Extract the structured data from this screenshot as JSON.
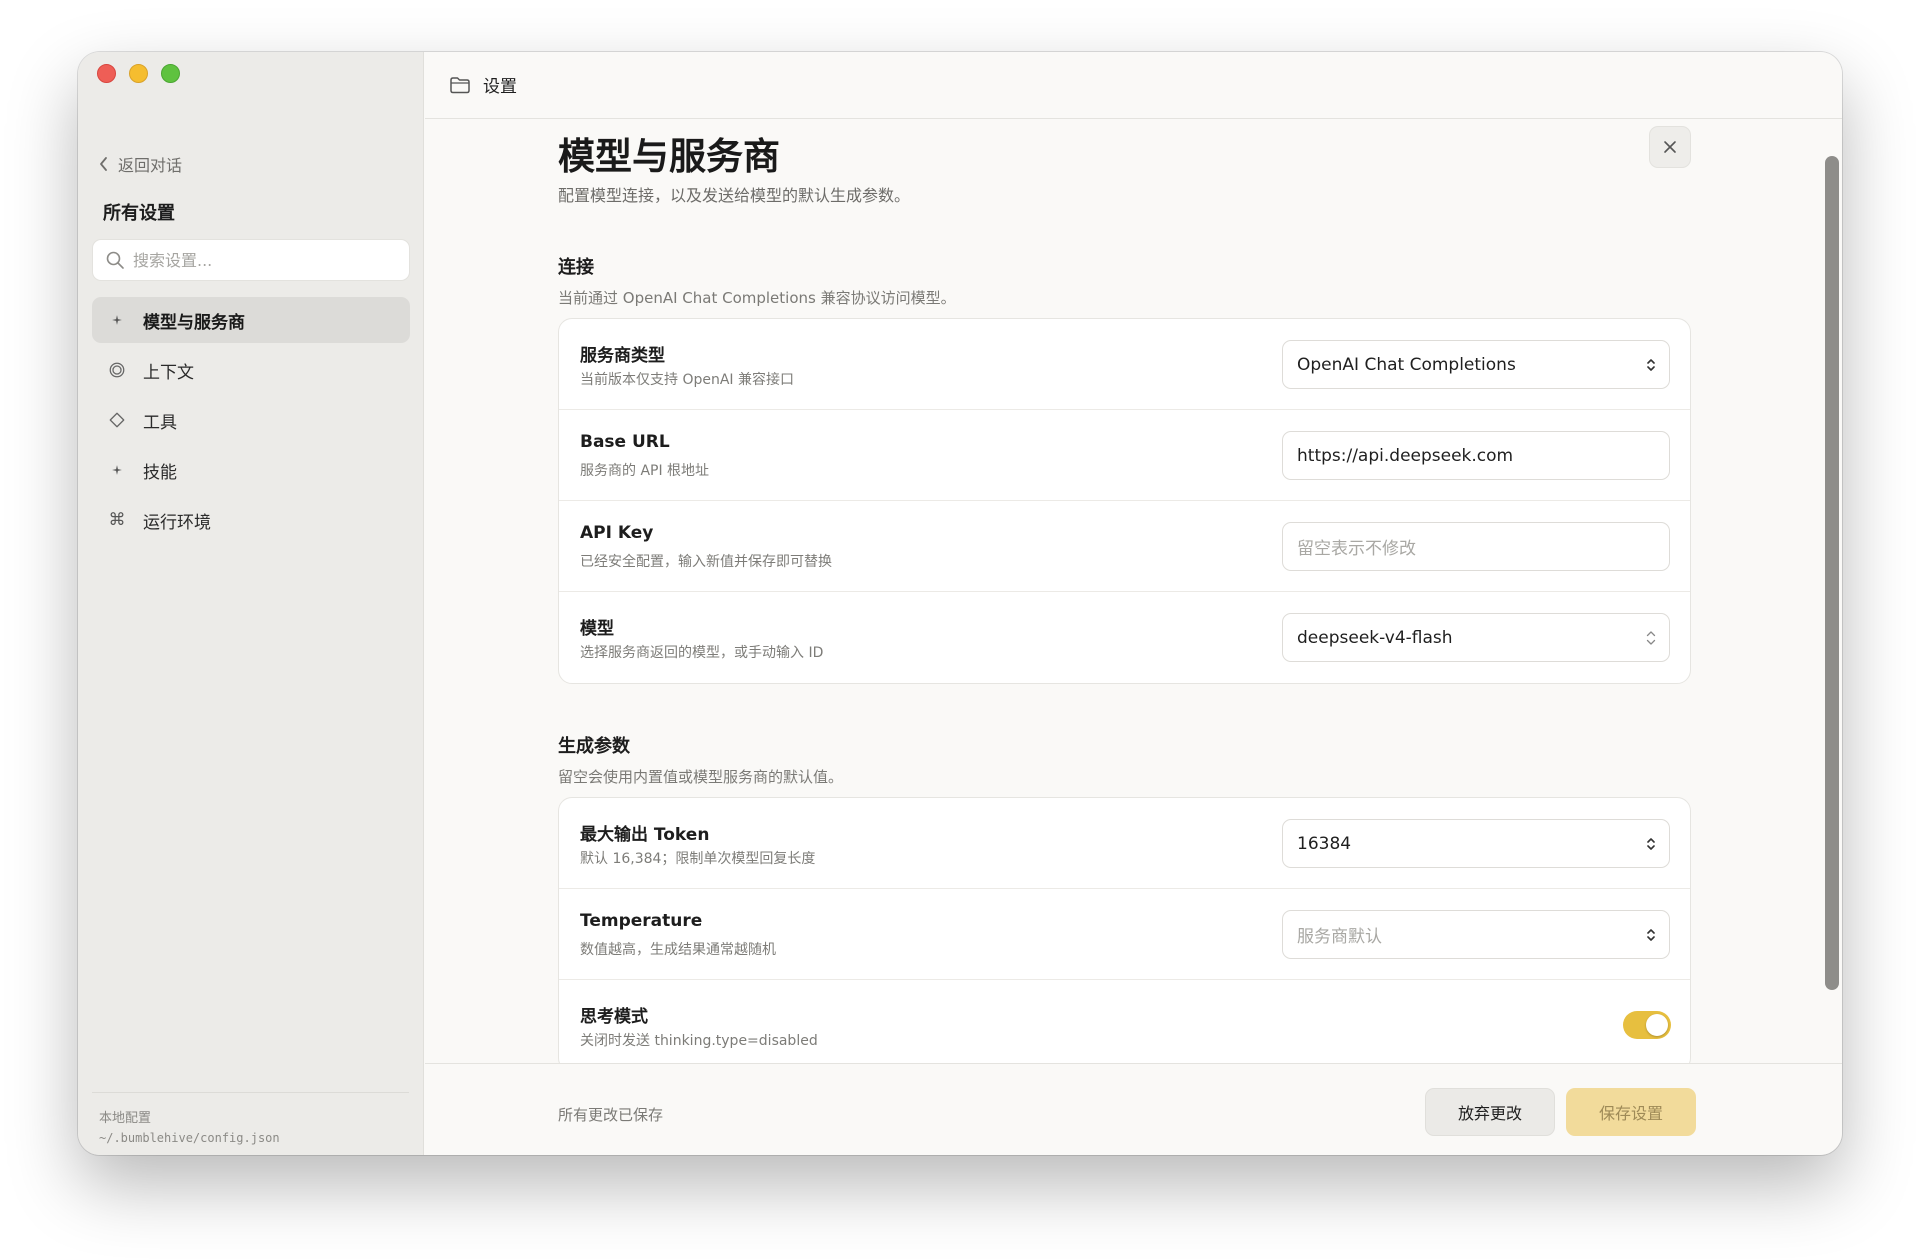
{
  "sidebar": {
    "back_label": "返回对话",
    "title": "所有设置",
    "search_placeholder": "搜索设置...",
    "items": [
      {
        "label": "模型与服务商",
        "icon": "sparkle-icon",
        "active": true
      },
      {
        "label": "上下文",
        "icon": "context-ring-icon",
        "active": false
      },
      {
        "label": "工具",
        "icon": "diamond-icon",
        "active": false
      },
      {
        "label": "技能",
        "icon": "sparkle-icon",
        "active": false
      },
      {
        "label": "运行环境",
        "icon": "command-icon",
        "active": false
      }
    ],
    "footer": {
      "label": "本地配置",
      "path": "~/.bumblehive/config.json"
    }
  },
  "topbar": {
    "breadcrumb": "设置"
  },
  "page": {
    "title": "模型与服务商",
    "description": "配置模型连接，以及发送给模型的默认生成参数。"
  },
  "connection": {
    "title": "连接",
    "description": "当前通过 OpenAI Chat Completions 兼容协议访问模型。",
    "rows": [
      {
        "label": "服务商类型",
        "hint": "当前版本仅支持 OpenAI 兼容接口",
        "value": "OpenAI Chat Completions",
        "placeholder": ""
      },
      {
        "label": "Base URL",
        "hint": "服务商的 API 根地址",
        "value": "https://api.deepseek.com",
        "placeholder": ""
      },
      {
        "label": "API Key",
        "hint": "已经安全配置，输入新值并保存即可替换",
        "value": "",
        "placeholder": "留空表示不修改"
      },
      {
        "label": "模型",
        "hint": "选择服务商返回的模型，或手动输入 ID",
        "value": "deepseek-v4-flash",
        "placeholder": ""
      }
    ]
  },
  "generation": {
    "title": "生成参数",
    "description": "留空会使用内置值或模型服务商的默认值。",
    "rows": [
      {
        "label": "最大输出 Token",
        "hint": "默认 16,384；限制单次模型回复长度",
        "value": "16384",
        "placeholder": ""
      },
      {
        "label": "Temperature",
        "hint": "数值越高，生成结果通常越随机",
        "value": "",
        "placeholder": "服务商默认"
      },
      {
        "label": "思考模式",
        "hint": "关闭时发送 thinking.type=disabled",
        "toggle_on": true
      }
    ]
  },
  "footer_bar": {
    "status": "所有更改已保存",
    "discard_label": "放弃更改",
    "save_label": "保存设置"
  },
  "colors": {
    "accent": "#e7bf3f",
    "save_button": "#f2db9b",
    "sidebar_bg": "#ecebe8"
  }
}
